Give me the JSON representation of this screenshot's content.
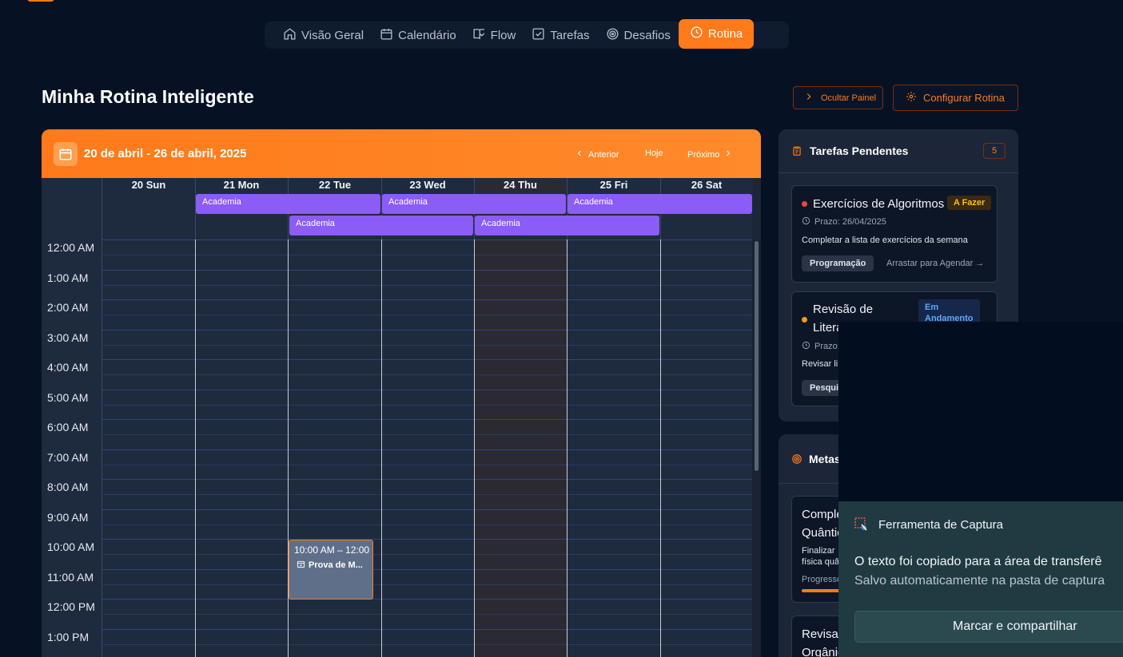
{
  "nav": {
    "items": [
      {
        "label": "Visão Geral",
        "icon": "home-icon"
      },
      {
        "label": "Calendário",
        "icon": "calendar-icon"
      },
      {
        "label": "Flow",
        "icon": "book-icon"
      },
      {
        "label": "Tarefas",
        "icon": "checkbox-icon"
      },
      {
        "label": "Desafios",
        "icon": "target-icon"
      },
      {
        "label": "Rotina",
        "icon": "clock-icon",
        "active": true
      }
    ]
  },
  "page": {
    "title": "Minha Rotina Inteligente",
    "hide_panel_label": "Ocultar Painel",
    "configure_label": "Configurar Rotina"
  },
  "calendar": {
    "range": "20 de abril - 26 de abril, 2025",
    "prev_label": "Anterior",
    "today_label": "Hoje",
    "next_label": "Próximo",
    "days": [
      "20 Sun",
      "21 Mon",
      "22 Tue",
      "23 Wed",
      "24 Thu",
      "25 Fri",
      "26 Sat"
    ],
    "today_index": 4,
    "allday_events": [
      {
        "label": "Academia"
      },
      {
        "label": "Academia"
      },
      {
        "label": "Academia"
      },
      {
        "label": "Academia"
      },
      {
        "label": "Academia"
      }
    ],
    "hours": [
      "12:00 AM",
      "1:00 AM",
      "2:00 AM",
      "3:00 AM",
      "4:00 AM",
      "5:00 AM",
      "6:00 AM",
      "7:00 AM",
      "8:00 AM",
      "9:00 AM",
      "10:00 AM",
      "11:00 AM",
      "12:00 PM",
      "1:00 PM"
    ],
    "timed_event": {
      "time": "10:00 AM – 12:00 PM",
      "title": "Prova de M..."
    }
  },
  "tasks_panel": {
    "title": "Tarefas Pendentes",
    "count": "5",
    "tasks": [
      {
        "title": "Exercícios de Algoritmos",
        "status": "A Fazer",
        "deadline": "Prazo: 26/04/2025",
        "description": "Completar a lista de exercícios da semana",
        "tag": "Programação",
        "drag_label": "Arrastar para Agendar →",
        "priority_color": "#ef4444"
      },
      {
        "title_line1": "Revisão de",
        "title_line2": "Litera",
        "status_line1": "Em",
        "status_line2": "Andamento",
        "deadline": "Prazo:",
        "description": "Revisar li",
        "tag": "Pesqui",
        "priority_color": "#f59e0b"
      }
    ]
  },
  "goals_panel": {
    "title": "Metas",
    "goals": [
      {
        "title_line1": "Comple",
        "title_line2": "Quântic",
        "desc_line1": "Finalizar",
        "desc_line2": "física quâ",
        "progress_label": "Progresso"
      },
      {
        "title_line1": "Revisar",
        "title_line2": "Orgânic"
      }
    ]
  },
  "toast": {
    "app_name": "Ferramenta de Captura",
    "line1": "O texto foi copiado para a área de transferê",
    "line2": "Salvo automaticamente na pasta de captura",
    "button_label": "Marcar e compartilhar"
  },
  "colors": {
    "accent": "#ff7a1a",
    "event": "#8b5cf6",
    "background": "#061224"
  }
}
